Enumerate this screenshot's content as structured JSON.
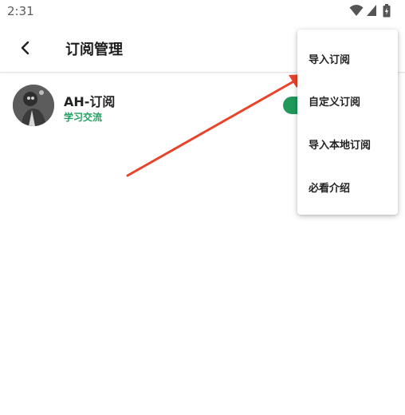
{
  "status_bar": {
    "time": "2:31",
    "icons": [
      "wifi-icon",
      "signal-icon",
      "battery-icon"
    ]
  },
  "app_bar": {
    "back_icon": "back-arrow-icon",
    "title": "订阅管理"
  },
  "subscriptions": [
    {
      "name": "AH-订阅",
      "group": "学习交流",
      "group_color": "#1fa060",
      "enabled": true,
      "toggle_color": "#1f9a5a"
    }
  ],
  "menu": {
    "items": [
      {
        "label": "导入订阅"
      },
      {
        "label": "自定义订阅"
      },
      {
        "label": "导入本地订阅"
      },
      {
        "label": "必看介绍"
      }
    ]
  },
  "annotation": {
    "arrow_color": "#e8432b",
    "target": "导入订阅"
  }
}
